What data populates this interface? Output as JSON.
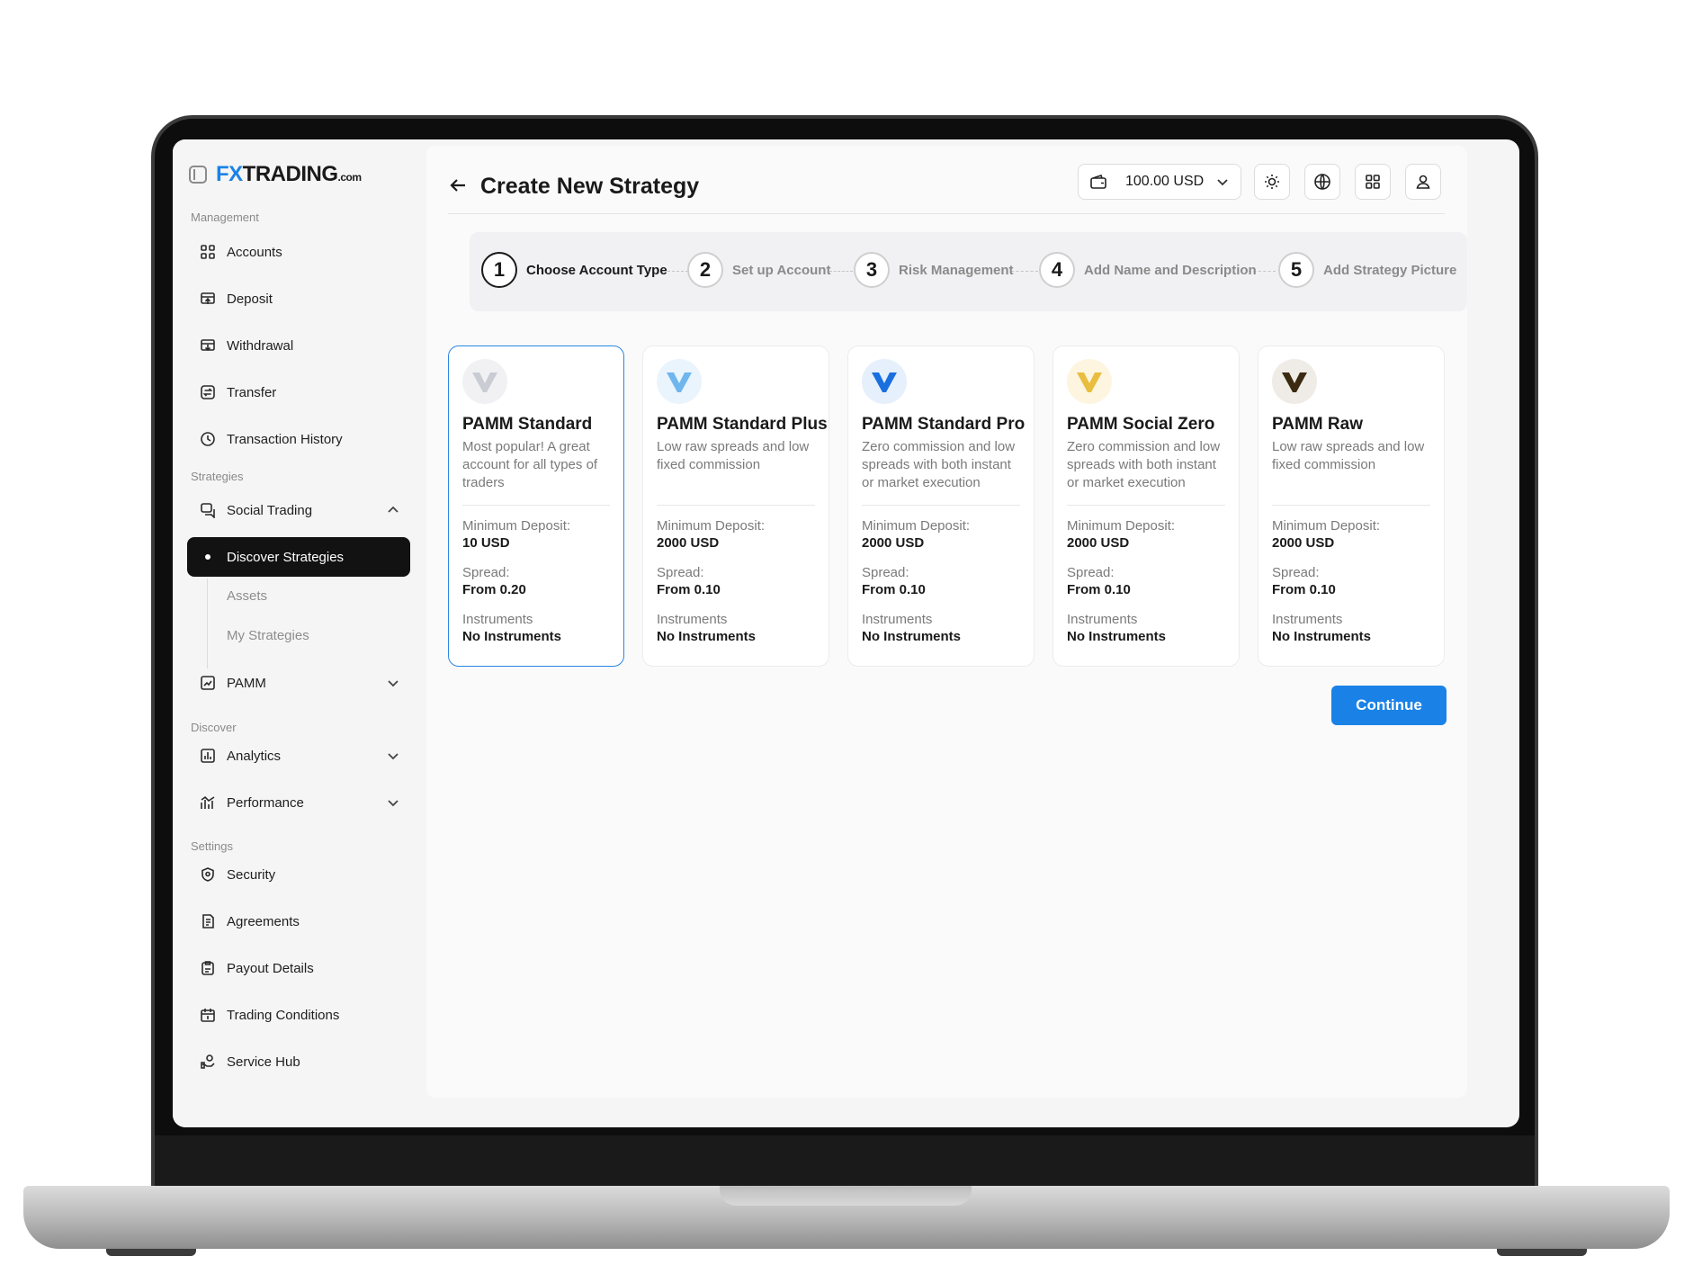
{
  "brand": {
    "fx": "FX",
    "name": "TRADING",
    "suffix": ".com"
  },
  "sidebar": {
    "sections": {
      "management": "Management",
      "strategies": "Strategies",
      "discover": "Discover",
      "settings": "Settings"
    },
    "items": {
      "accounts": "Accounts",
      "deposit": "Deposit",
      "withdrawal": "Withdrawal",
      "transfer": "Transfer",
      "transaction_history": "Transaction History",
      "social_trading": "Social Trading",
      "discover_strategies": "Discover Strategies",
      "assets": "Assets",
      "my_strategies": "My Strategies",
      "pamm": "PAMM",
      "analytics": "Analytics",
      "performance": "Performance",
      "security": "Security",
      "agreements": "Agreements",
      "payout_details": "Payout Details",
      "trading_conditions": "Trading Conditions",
      "service_hub": "Service Hub"
    }
  },
  "header": {
    "title": "Create New Strategy",
    "balance": "100.00 USD"
  },
  "steps": [
    {
      "num": "1",
      "label": "Choose Account Type"
    },
    {
      "num": "2",
      "label": "Set up Account"
    },
    {
      "num": "3",
      "label": "Risk Management"
    },
    {
      "num": "4",
      "label": "Add Name and Description"
    },
    {
      "num": "5",
      "label": "Add Strategy Picture"
    }
  ],
  "labels": {
    "min_deposit": "Minimum Deposit:",
    "spread": "Spread:",
    "instruments": "Instruments"
  },
  "cards": [
    {
      "title": "PAMM Standard",
      "desc": "Most popular! A great account for all types of traders",
      "min_deposit": "10 USD",
      "spread": "From 0.20",
      "instruments": "No Instruments",
      "color": "#c9ccd3"
    },
    {
      "title": "PAMM Standard Plus",
      "desc": "Low raw spreads and low fixed commission",
      "min_deposit": "2000 USD",
      "spread": "From 0.10",
      "instruments": "No Instruments",
      "color": "#6fb6ef"
    },
    {
      "title": "PAMM Standard Pro",
      "desc": "Zero commission and low spreads with both instant or market execution",
      "min_deposit": "2000 USD",
      "spread": "From 0.10",
      "instruments": "No Instruments",
      "color": "#1a6fe0"
    },
    {
      "title": "PAMM Social Zero",
      "desc": "Zero commission and low spreads with both instant or market execution",
      "min_deposit": "2000 USD",
      "spread": "From 0.10",
      "instruments": "No Instruments",
      "color": "#e9bd3f"
    },
    {
      "title": "PAMM Raw",
      "desc": "Low raw spreads and low fixed commission",
      "min_deposit": "2000 USD",
      "spread": "From 0.10",
      "instruments": "No Instruments",
      "color": "#3b2a10"
    }
  ],
  "actions": {
    "continue": "Continue"
  },
  "colors": {
    "accent": "#1a82e6",
    "active_nav": "#121212",
    "selected_border": "#2a86e3"
  }
}
